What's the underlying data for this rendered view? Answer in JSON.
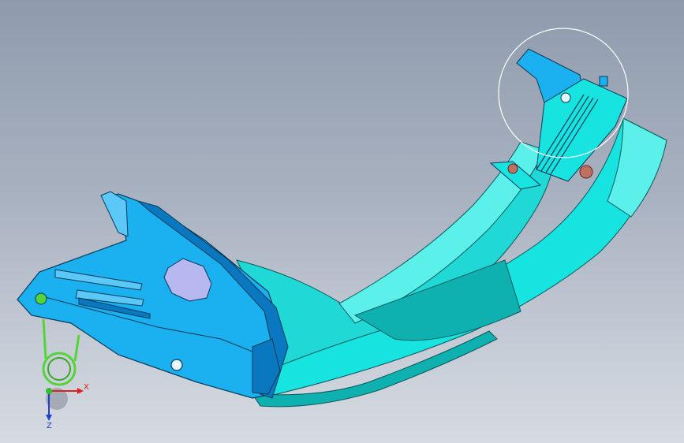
{
  "viewport": {
    "background_top": "#8f9bad",
    "background_bottom": "#d6dbe2"
  },
  "model": {
    "colors": {
      "body": "#1bb0f0",
      "body_light": "#5cc8f8",
      "body_dark": "#0a78c0",
      "arm": "#17e4e0",
      "arm_light": "#5cf0ea",
      "arm_dark": "#0fb0b0",
      "spring": "#55d43a",
      "bolt": "#c07060",
      "cover": "#b8b8f0",
      "edge": "#0a3a55"
    }
  },
  "selection_circle": {
    "color": "#ffffff"
  },
  "triad": {
    "x_label": "X",
    "z_label": "Z",
    "x_color": "#e02020",
    "z_color": "#2040d0",
    "origin_color": "#30c030"
  }
}
